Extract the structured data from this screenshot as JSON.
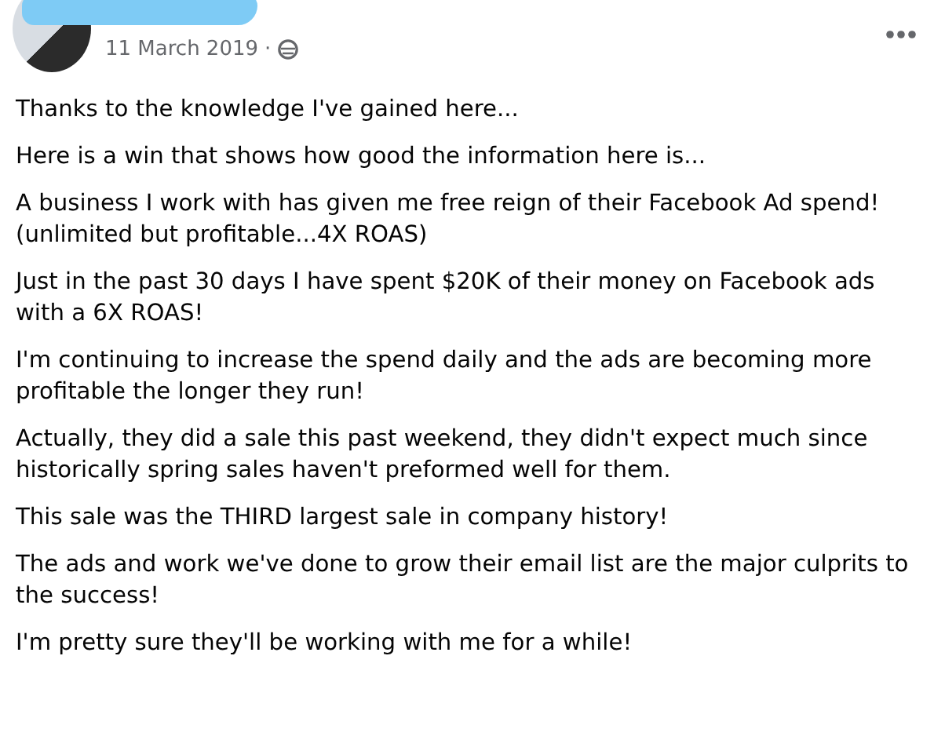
{
  "post": {
    "date": "11 March 2019",
    "separator": "·",
    "paragraphs": [
      "Thanks to the knowledge I've gained here...",
      "Here is a win that shows how good the information here is...",
      "A business I work with has given me free reign of their Facebook Ad spend! (unlimited but profitable...4X ROAS)",
      "Just in the past 30 days I have spent $20K of their money on Facebook ads with a 6X ROAS!",
      "I'm continuing to increase the spend daily and the ads are becoming more profitable the longer they run!",
      "Actually, they did a sale this past weekend, they didn't expect much since historically spring sales haven't preformed well for them.",
      "This sale was the THIRD largest sale in company history!",
      "The ads and work we've done to grow their email list are the major culprits to the success!",
      "I'm pretty sure they'll be working with me for a while!"
    ]
  }
}
